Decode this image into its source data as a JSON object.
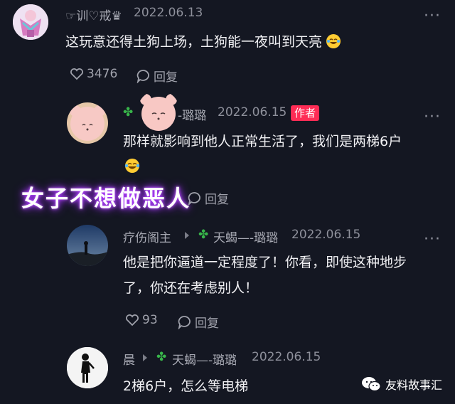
{
  "comments": [
    {
      "username": "☞训♡戒♛",
      "date": "2022.06.13",
      "text": "这玩意还得土狗上场，土狗能一夜叫到天亮",
      "likes": "3476",
      "reply_label": "回复"
    },
    {
      "username": "-璐璐",
      "author_badge": "作者",
      "date": "2022.06.15",
      "text_line1": "那样就影响到他人正常生活了，我们是两梯6户",
      "reply_label": "回复"
    },
    {
      "username": "疗伤阁主",
      "reply_to": "天蝎—-璐璐",
      "date": "2022.06.15",
      "text_line1": "他是把你逼道一定程度了！你看，即使这种地步",
      "text_line2": "了，你还在考虑别人！",
      "likes": "93",
      "reply_label": "回复"
    },
    {
      "username": "晨",
      "reply_to": "天蝎—-璐璐",
      "date": "2022.06.15",
      "text": "2梯6户，怎么等电梯"
    }
  ],
  "overlay_caption": "女子不想做恶人",
  "watermark": "友料故事汇",
  "colors": {
    "background": "#141722",
    "author_badge": "#fe2c55",
    "clover": "#38b54a",
    "glow": "#b13cff"
  }
}
